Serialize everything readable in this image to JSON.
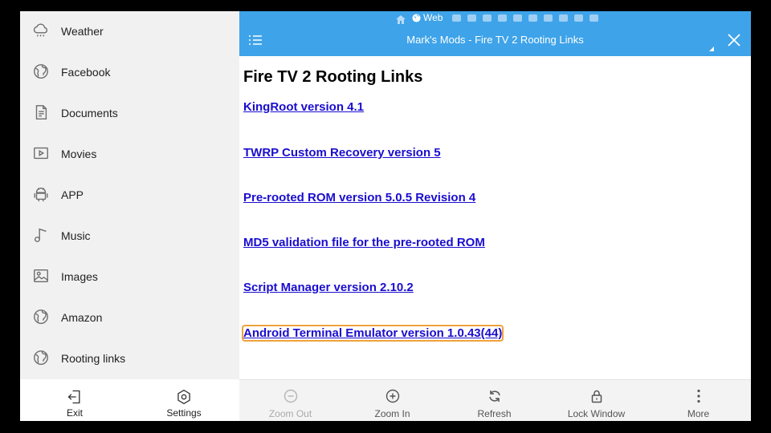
{
  "sidebar": {
    "items": [
      {
        "label": "Weather",
        "icon": "cloud-rain-icon"
      },
      {
        "label": "Facebook",
        "icon": "globe-icon"
      },
      {
        "label": "Documents",
        "icon": "document-icon"
      },
      {
        "label": "Movies",
        "icon": "movie-icon"
      },
      {
        "label": "APP",
        "icon": "android-icon"
      },
      {
        "label": "Music",
        "icon": "music-note-icon"
      },
      {
        "label": "Images",
        "icon": "image-icon"
      },
      {
        "label": "Amazon",
        "icon": "globe-icon"
      },
      {
        "label": "Rooting links",
        "icon": "globe-icon"
      }
    ],
    "bottom": {
      "exit_label": "Exit",
      "settings_label": "Settings"
    }
  },
  "browser": {
    "tab_bar_label": "Web",
    "title": "Mark's Mods - Fire TV 2 Rooting Links",
    "accent_color": "#3ea3e9"
  },
  "page": {
    "heading": "Fire TV 2 Rooting Links",
    "links": [
      "KingRoot version 4.1",
      "TWRP Custom Recovery version 5",
      "Pre-rooted ROM version 5.0.5 Revision 4",
      "MD5 validation file for the pre-rooted ROM",
      "Script Manager version 2.10.2",
      "Android Terminal Emulator version 1.0.43(44)"
    ],
    "link_color": "#1a0dce"
  },
  "bottom_bar": {
    "zoom_out": "Zoom Out",
    "zoom_in": "Zoom In",
    "refresh": "Refresh",
    "lock_window": "Lock Window",
    "more": "More"
  }
}
